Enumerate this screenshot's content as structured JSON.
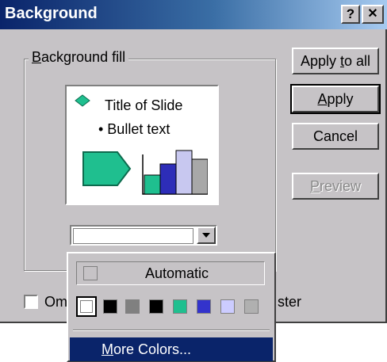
{
  "window": {
    "title": "Background",
    "help_button": "?",
    "close_button": "✕"
  },
  "group": {
    "label_prefix": "",
    "label_hotkey": "B",
    "label_rest": "ackground fill"
  },
  "preview": {
    "title": "Title of Slide",
    "bullet": "• Bullet text"
  },
  "buttons": {
    "apply_to_all": {
      "pre": "Apply ",
      "hot": "t",
      "post": "o all"
    },
    "apply": {
      "pre": "",
      "hot": "A",
      "post": "pply"
    },
    "cancel": "Cancel",
    "preview": {
      "pre": "",
      "hot": "P",
      "post": "review"
    }
  },
  "omit": {
    "label_start": "Om",
    "label_end": "ster",
    "checked": false
  },
  "color_menu": {
    "automatic": "Automatic",
    "more_colors": {
      "pre": "",
      "hot": "M",
      "post": "ore Colors..."
    },
    "swatches": [
      "#ffffff",
      "#000000",
      "#808080",
      "#000000",
      "#1fbf8f",
      "#3333cc",
      "#ccccff",
      "#b0b0b0"
    ],
    "selected": "#ffffff"
  },
  "colors": {
    "accent": "#0a246a",
    "dialog_bg": "#c6c3c6",
    "shape_green": "#1fbf8f",
    "bar_blue": "#2d2db8",
    "bar_lavender": "#c8c8f0",
    "bar_gray": "#a8a8a8"
  }
}
